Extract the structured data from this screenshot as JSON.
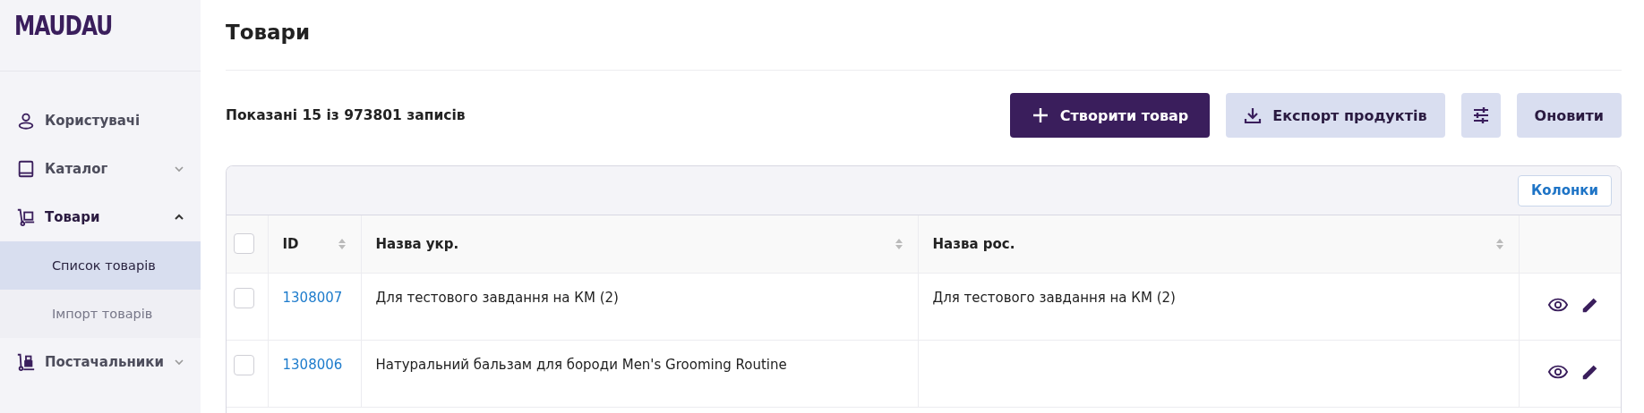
{
  "sidebar": {
    "logo": "MAUDAU",
    "items": [
      {
        "label": "Користувачі"
      },
      {
        "label": "Каталог",
        "expanded": false
      },
      {
        "label": "Товари",
        "expanded": true,
        "children": [
          {
            "label": "Список товарів",
            "selected": true
          },
          {
            "label": "Імпорт товарів",
            "selected": false
          }
        ]
      },
      {
        "label": "Постачальники",
        "expanded": false
      }
    ]
  },
  "page": {
    "title": "Товари",
    "count_text": "Показані 15 із 973801 записів",
    "buttons": [
      {
        "kind": "primary",
        "label": "Створити товар"
      },
      {
        "kind": "secondary",
        "label": "Експорт продуктів"
      },
      {
        "kind": "icon"
      },
      {
        "kind": "secondary",
        "label": "Оновити"
      }
    ]
  },
  "table": {
    "columns_button": "Колонки",
    "select_all": {
      "checked": false
    },
    "columns": [
      {
        "label": "ID",
        "sortable": true
      },
      {
        "label": "Назва укр.",
        "sortable": true
      },
      {
        "label": "Назва рос.",
        "sortable": true
      }
    ],
    "rows": [
      {
        "checked": false,
        "id": "1308007",
        "name_ua": "Для тестового завдання на КМ (2)",
        "name_ru": "Для тестового завдання на КМ (2)"
      },
      {
        "checked": false,
        "id": "1308006",
        "name_ua": "Натуральний бальзам для бороди Men's Grooming Routine"
      }
    ]
  }
}
